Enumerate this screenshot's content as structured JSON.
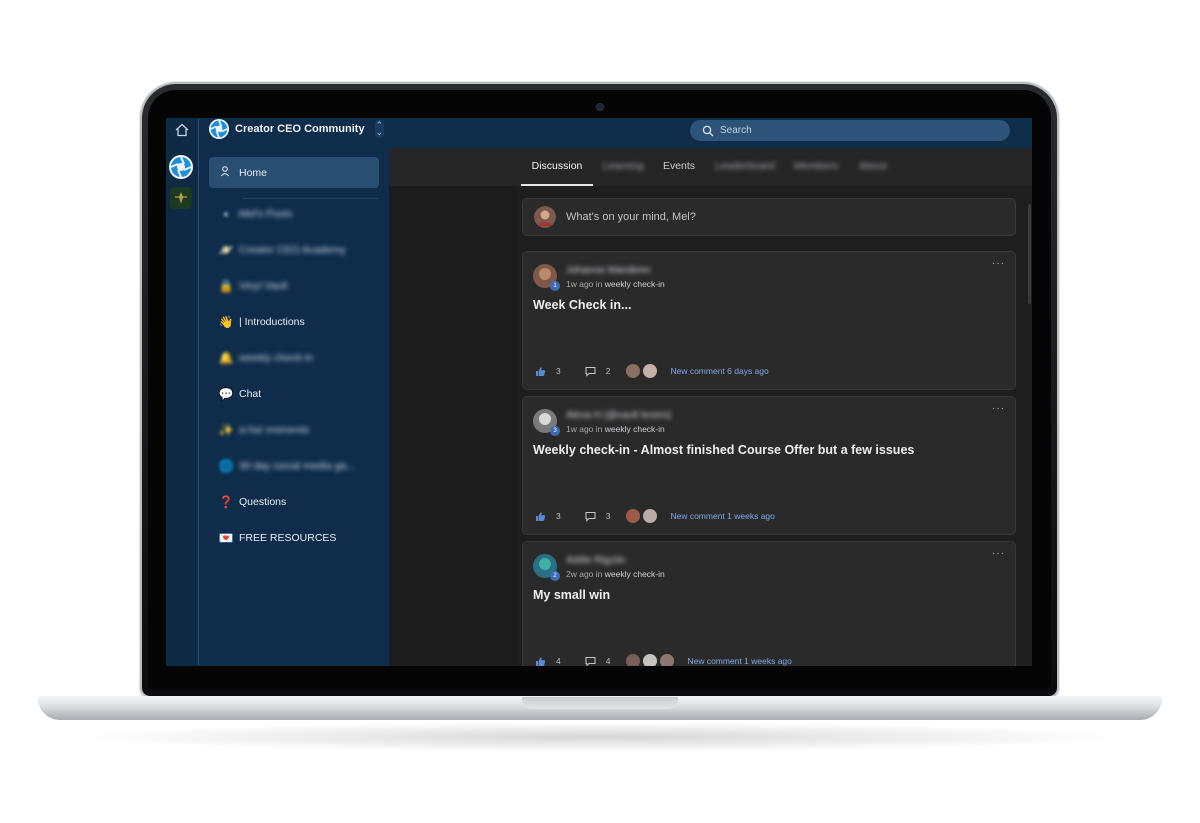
{
  "community": {
    "name": "Creator CEO Community",
    "switch_icon": "chevron-up-down-icon"
  },
  "search": {
    "placeholder": "Search"
  },
  "nav": {
    "items": [
      {
        "label": "Home",
        "icon": "users-icon",
        "active": true,
        "blurred": false
      },
      {
        "label": "Mel's Posts",
        "icon": "pink-square-icon",
        "blurred": true
      },
      {
        "label": "Creator CEO Academy",
        "icon": "planet-icon",
        "blurred": true
      },
      {
        "label": "Vinyl Vault",
        "icon": "lock-icon",
        "blurred": true
      },
      {
        "label": "| Introductions",
        "icon": "wave-icon",
        "glyph": "👋",
        "blurred": false
      },
      {
        "label": "weekly check-in",
        "icon": "bell-icon",
        "blurred": true
      },
      {
        "label": "Chat",
        "icon": "speech-bubble-icon",
        "glyph": "💬",
        "blurred": false
      },
      {
        "label": "a-ha! moments",
        "icon": "sparkle-icon",
        "blurred": true
      },
      {
        "label": "30 day social media ga...",
        "icon": "globe-icon",
        "blurred": true
      },
      {
        "label": "Questions",
        "icon": "question-mark-icon",
        "glyph": "❓",
        "blurred": false
      },
      {
        "label": "FREE RESOURCES",
        "icon": "heart-letter-icon",
        "glyph": "💌",
        "blurred": false
      }
    ]
  },
  "tabs": [
    {
      "label": "Discussion",
      "active": true,
      "blurred": false
    },
    {
      "label": "Learning",
      "blurred": true
    },
    {
      "label": "Events",
      "blurred": false
    },
    {
      "label": "Leaderboard",
      "blurred": true
    },
    {
      "label": "Members",
      "blurred": true
    },
    {
      "label": "About",
      "blurred": true
    }
  ],
  "composer": {
    "placeholder": "What's on your mind, Mel?"
  },
  "posts": [
    {
      "author": "Johanna Wanderer",
      "level": "1",
      "time": "1w ago in ",
      "category": "weekly check-in",
      "title": "Week Check in...",
      "likes": "3",
      "comments": "2",
      "last_comment": "New comment 6 days ago"
    },
    {
      "author": "Alexa H (@vault lovers)",
      "level": "3",
      "time": "1w ago in ",
      "category": "weekly check-in",
      "title": "Weekly check-in - Almost finished Course Offer but a few issues",
      "likes": "3",
      "comments": "3",
      "last_comment": "New comment 1 weeks ago"
    },
    {
      "author": "Addie Rigzdn",
      "level": "2",
      "time": "2w ago in ",
      "category": "weekly check-in",
      "title": "My small win",
      "likes": "4",
      "comments": "4",
      "last_comment": "New comment 1 weeks ago"
    }
  ],
  "colors": {
    "sidebar": "#0f2d4b",
    "accent_link": "#7ea9e6",
    "card": "#2a2a2b",
    "page": "#1e1e1f"
  }
}
